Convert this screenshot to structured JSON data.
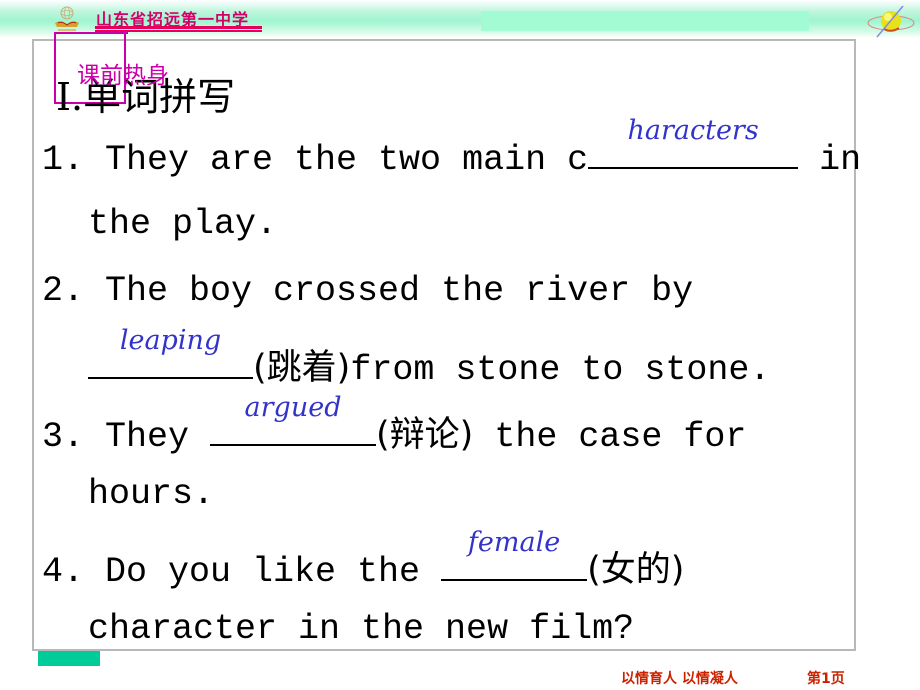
{
  "header": {
    "school_name": "山东省招远第一中学",
    "logo_icon": "school-emblem-icon",
    "globe_icon": "globe-orbit-icon"
  },
  "section": {
    "tag": "课前热身",
    "title": "Ⅰ.单词拼写"
  },
  "questions": [
    {
      "number": "1.",
      "line1_before": "1. They are the two main c",
      "answer": "haracters",
      "line1_after": " in",
      "line2": "the play."
    },
    {
      "number": "2.",
      "line1": "2. The boy crossed the river by",
      "answer": "leaping",
      "hint": "(跳着)",
      "line2_after": "from stone to stone."
    },
    {
      "number": "3.",
      "line1_before": "3. They ",
      "answer": "argued",
      "hint": "(辩论)",
      "line1_after": " the case for",
      "line2": "hours."
    },
    {
      "number": "4.",
      "line1_before": "4. Do you like the ",
      "answer": "female",
      "hint": "(女的)",
      "line2": "character in the new film?"
    }
  ],
  "footer": {
    "motto": "以情育人 以情凝人",
    "page": "第1页"
  }
}
